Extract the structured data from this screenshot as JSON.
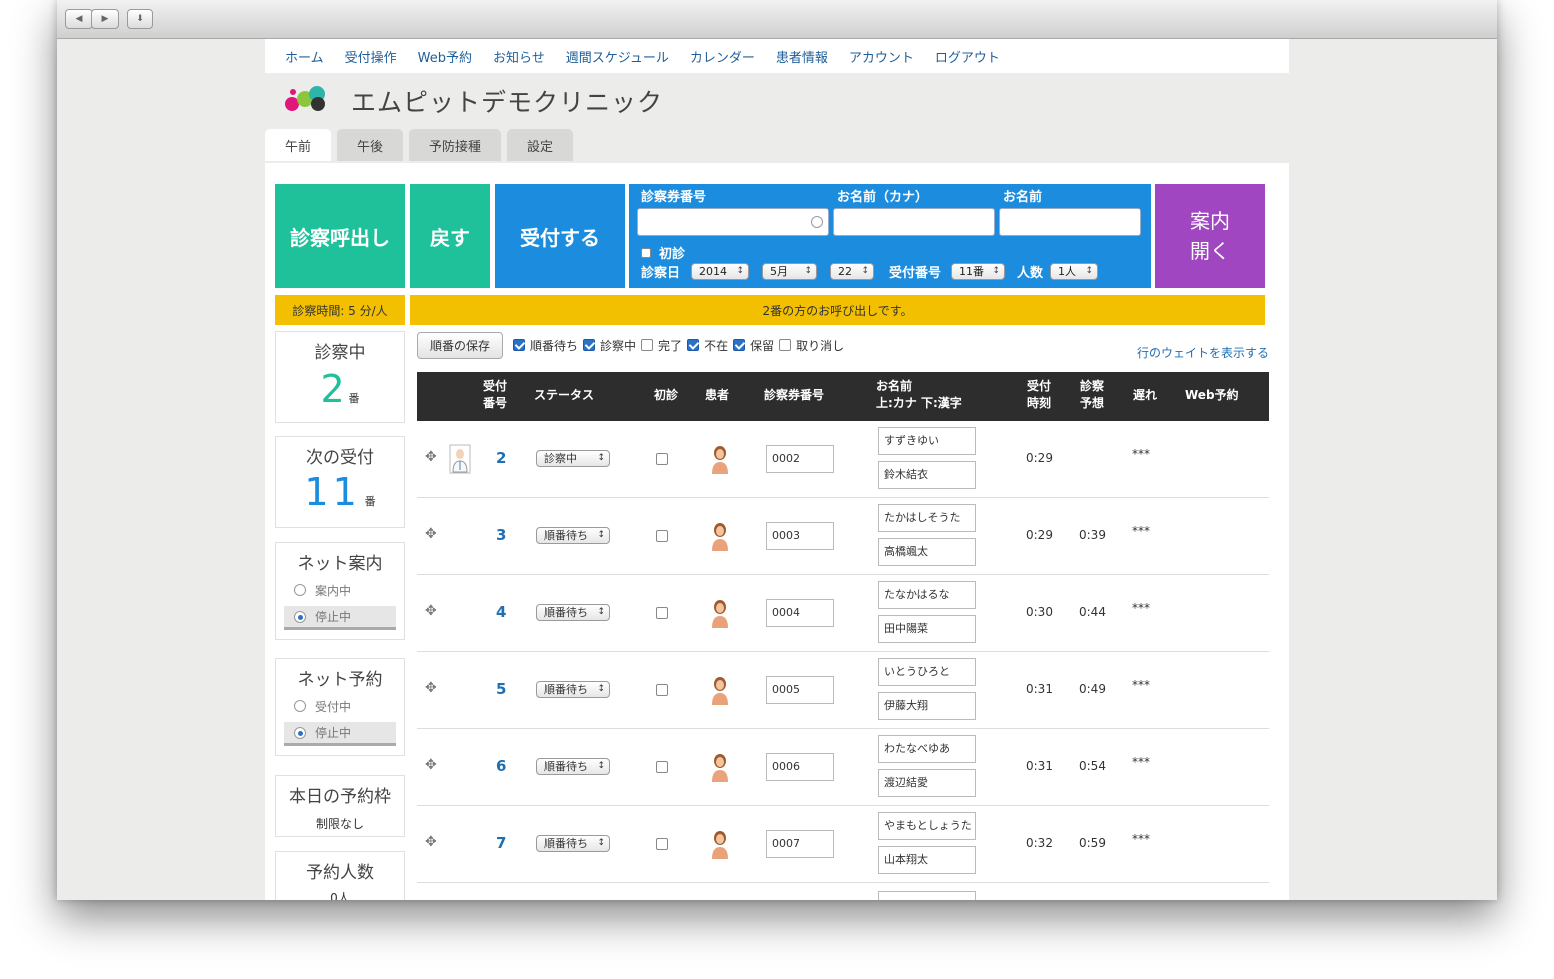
{
  "nav": [
    "ホーム",
    "受付操作",
    "Web予約",
    "お知らせ",
    "週間スケジュール",
    "カレンダー",
    "患者情報",
    "アカウント",
    "ログアウト"
  ],
  "clinic_name": "エムピットデモクリニック",
  "tabs": [
    "午前",
    "午後",
    "予防接種",
    "設定"
  ],
  "buttons": {
    "call": "診察呼出し",
    "back": "戻す",
    "accept": "受付する",
    "guide": "案内\n開く"
  },
  "form": {
    "card_no_label": "診察券番号",
    "kana_label": "お名前（カナ）",
    "name_label": "お名前",
    "first_visit_label": "初診",
    "date_label": "診察日",
    "year": "2014",
    "month": "5月",
    "day": "22",
    "ticket_label": "受付番号",
    "ticket": "11番",
    "people_label": "人数",
    "people": "1人"
  },
  "consult_time": "診察時間: 5 分/人",
  "notice": "2番の方のお呼び出しです。",
  "side": {
    "in_consult_title": "診察中",
    "in_consult_num": "2",
    "in_consult_suffix": "番",
    "next_title": "次の受付",
    "next_num": "11",
    "next_suffix": "番",
    "net_guide_title": "ネット案内",
    "net_guide_on": "案内中",
    "net_guide_off": "停止中",
    "net_res_title": "ネット予約",
    "net_res_on": "受付中",
    "net_res_off": "停止中",
    "slots_title": "本日の予約枠",
    "slots_value": "制限なし",
    "res_count_title": "予約人数",
    "res_count_value": "0人"
  },
  "filters": {
    "save": "順番の保存",
    "waiting": "順番待ち",
    "consulting": "診察中",
    "done": "完了",
    "absent": "不在",
    "hold": "保留",
    "cancel": "取り消し",
    "weight_link": "行のウェイトを表示する"
  },
  "table": {
    "h_ticket": "受付\n番号",
    "h_status": "ステータス",
    "h_first": "初診",
    "h_patient": "患者",
    "h_card": "診察券番号",
    "h_name": "お名前\n上:カナ 下:漢字",
    "h_time": "受付\n時刻",
    "h_est": "診察\n予想",
    "h_late": "遅れ",
    "h_web": "Web予約"
  },
  "rows": [
    {
      "num": "2",
      "status": "診察中",
      "card": "0002",
      "kana": "すずきゆい",
      "kanji": "鈴木結衣",
      "time": "0:29",
      "est": "",
      "late": "***"
    },
    {
      "num": "3",
      "status": "順番待ち",
      "card": "0003",
      "kana": "たかはしそうた",
      "kanji": "高橋颯太",
      "time": "0:29",
      "est": "0:39",
      "late": "***"
    },
    {
      "num": "4",
      "status": "順番待ち",
      "card": "0004",
      "kana": "たなかはるな",
      "kanji": "田中陽菜",
      "time": "0:30",
      "est": "0:44",
      "late": "***"
    },
    {
      "num": "5",
      "status": "順番待ち",
      "card": "0005",
      "kana": "いとうひろと",
      "kanji": "伊藤大翔",
      "time": "0:31",
      "est": "0:49",
      "late": "***"
    },
    {
      "num": "6",
      "status": "順番待ち",
      "card": "0006",
      "kana": "わたなべゆあ",
      "kanji": "渡辺結愛",
      "time": "0:31",
      "est": "0:54",
      "late": "***"
    },
    {
      "num": "7",
      "status": "順番待ち",
      "card": "0007",
      "kana": "やまもとしょうた",
      "kanji": "山本翔太",
      "time": "0:32",
      "est": "0:59",
      "late": "***"
    }
  ]
}
